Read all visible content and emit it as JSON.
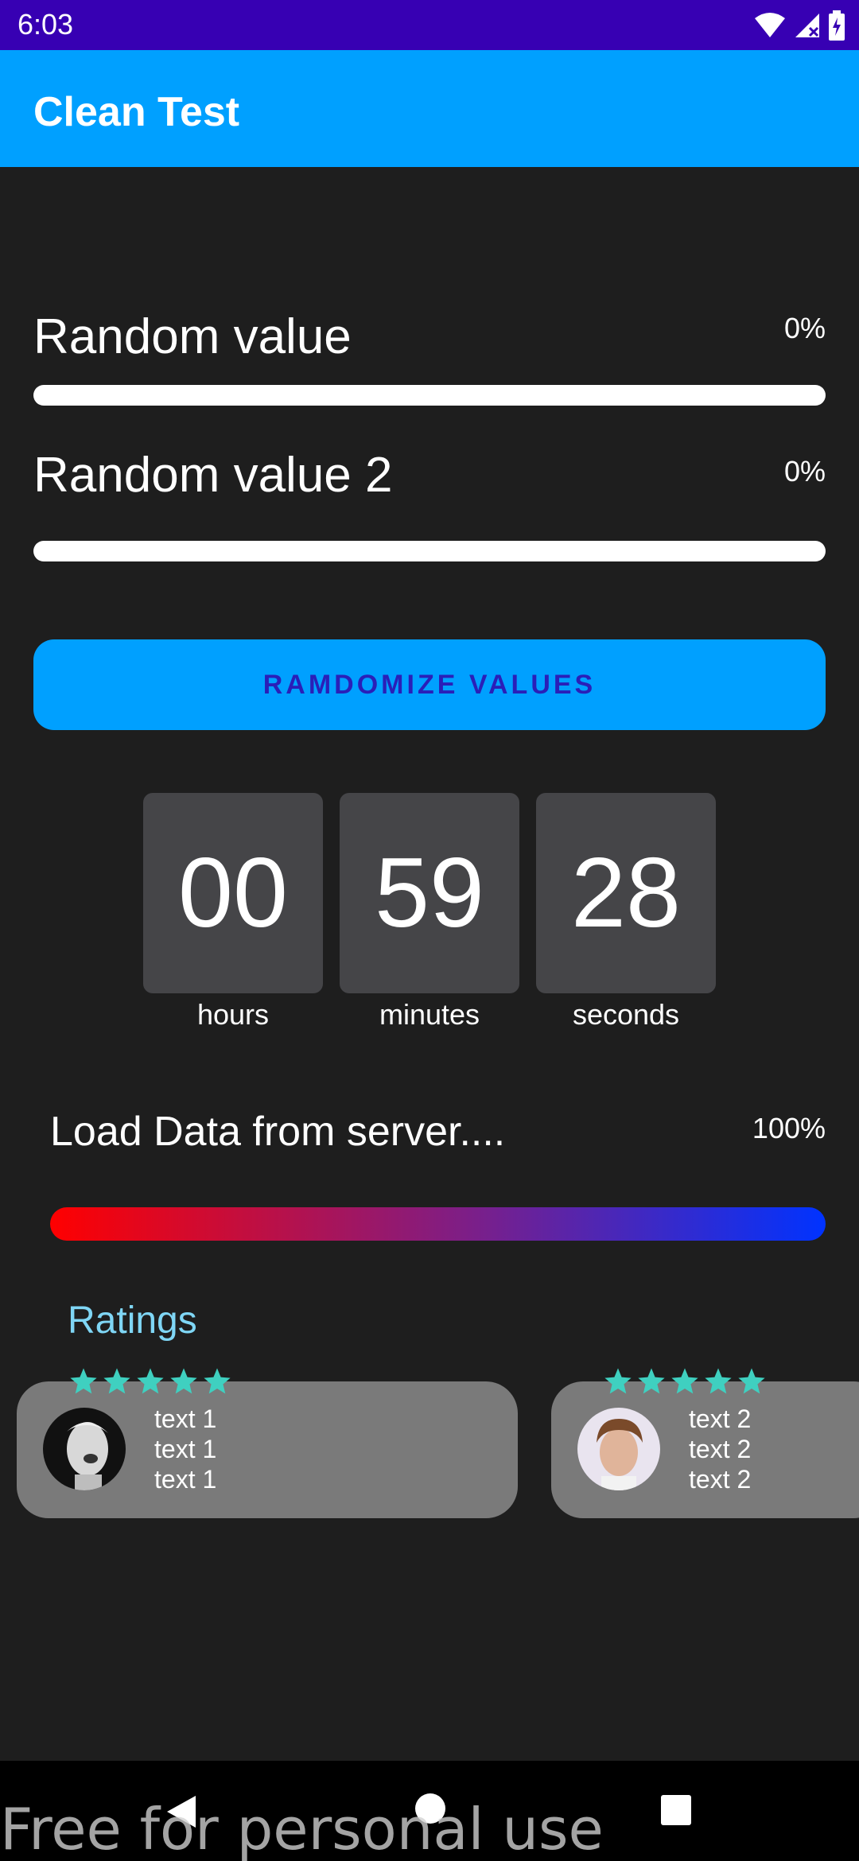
{
  "status_bar": {
    "time": "6:03",
    "icons": [
      "wifi-icon",
      "signal-icon",
      "battery-icon"
    ],
    "background": "#3700b3"
  },
  "app_bar": {
    "title": "Clean Test",
    "background": "#00a0ff"
  },
  "random_values": [
    {
      "label": "Random value",
      "percent_text": "0%",
      "progress": 0
    },
    {
      "label": "Random value 2",
      "percent_text": "0%",
      "progress": 0
    }
  ],
  "randomize_button": {
    "label": "RAMDOMIZE VALUES"
  },
  "countdown": {
    "hours": "00",
    "minutes": "59",
    "seconds": "28",
    "hours_label": "hours",
    "minutes_label": "minutes",
    "seconds_label": "seconds"
  },
  "load": {
    "label": "Load Data from server....",
    "percent_text": "100%",
    "progress": 1.0,
    "gradient": [
      "#ff0000",
      "#0033ff"
    ]
  },
  "ratings": {
    "title": "Ratings",
    "accent": "#3fd0c0",
    "cards": [
      {
        "stars": 5,
        "avatar": "woman-laughing-avatar",
        "lines": [
          "text 1",
          "text 1",
          "text 1"
        ]
      },
      {
        "stars": 5,
        "avatar": "young-man-avatar",
        "lines": [
          "text 2",
          "text 2",
          "text 2"
        ]
      }
    ]
  },
  "nav_bar": {
    "buttons": [
      "back-icon",
      "home-icon",
      "recents-icon"
    ]
  },
  "watermark": "Free for personal use"
}
